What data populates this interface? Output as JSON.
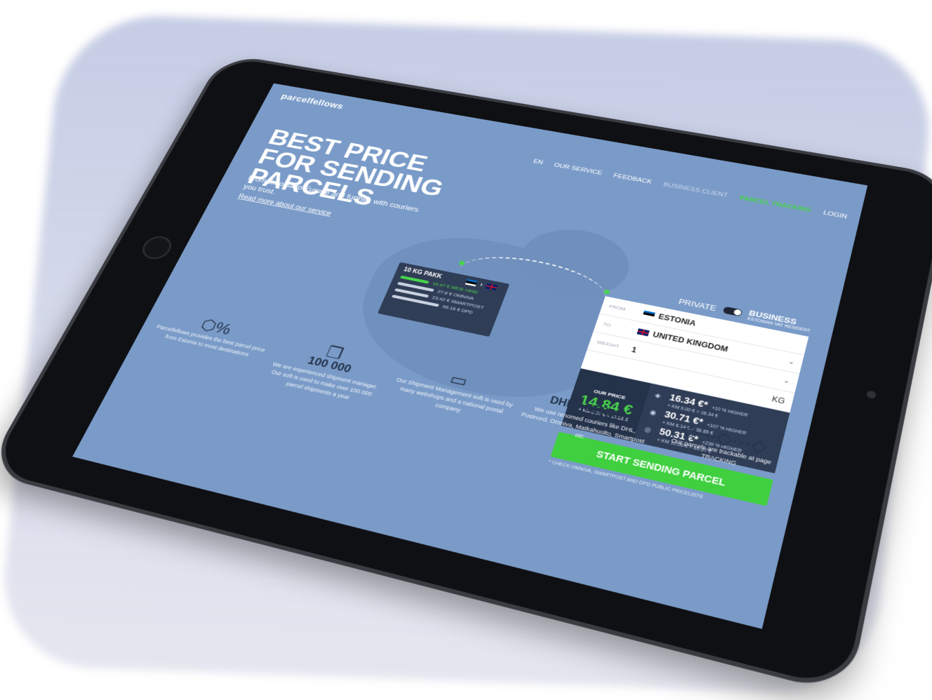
{
  "brand": "parcelfellows",
  "nav": {
    "items": [
      "EN",
      "OUR SERVICE",
      "FEEDBACK",
      "BUSINESS CLIENT",
      "PARCEL TRACKING",
      "LOGIN"
    ]
  },
  "hero": {
    "title": "BEST PRICE FOR SENDING PARCELS",
    "subtitle": "From Estonia to Europe and further, with couriers you trust.",
    "link": "Read more about our service"
  },
  "preview_card": {
    "title": "10 KG PAKK",
    "rows": [
      {
        "text": "16.47 € MEIE HIND",
        "highlight": true,
        "fill": 0.55
      },
      {
        "text": "27.6 € OMNIVA",
        "highlight": false,
        "fill": 0.7
      },
      {
        "text": "23.42 € SMARTPOST",
        "highlight": false,
        "fill": 0.65
      },
      {
        "text": "96.16 € DPD",
        "highlight": false,
        "fill": 0.9
      }
    ]
  },
  "form": {
    "private_label": "PRIVATE",
    "business_label": "BUSINESS",
    "business_sub": "ESTONIAN VAT RESIDENT",
    "from_label": "FROM",
    "from_value": "ESTONIA",
    "to_label": "TO",
    "to_value": "UNITED KINGDOM",
    "weight_label": "WEIGHT",
    "weight_value": "1",
    "weight_unit": "KG",
    "our_price_label": "OUR PRICE",
    "our_price": "14.84 €",
    "our_price_note": "+ KM 2.97 € = 17.81 €",
    "alternatives": [
      {
        "price": "16.34 €*",
        "note": "+10 % HIGHER",
        "km": "+ KM 0.00 € = 16.34 €"
      },
      {
        "price": "30.71 €*",
        "note": "+107 % HIGHER",
        "km": "+ KM 6.14 € = 36.85 €"
      },
      {
        "price": "50.31 €*",
        "note": "+239 % HIGHER",
        "km": "+ KM 10.06 € = 60.37 €"
      }
    ],
    "cta": "START SENDING PARCEL",
    "footnote": "* CHECK OMNIVA, SMARTPOST AND DPD PUBLIC PRICELISTS"
  },
  "features": [
    {
      "icon": "percent-badge-icon",
      "big": "",
      "text": "Parcelfellows provides the best parcel price from Estonia to most destinations"
    },
    {
      "icon": "boxes-icon",
      "big": "100 000",
      "text": "We are experienced shipment manager. Our soft is used to make over 100 000 parcel shipments a year"
    },
    {
      "icon": "certificate-icon",
      "big": "",
      "text": "Our Shipment Management soft is used by many webshops and a national postal company"
    },
    {
      "icon": "courier-logos-icon",
      "big": "DHL  ASENDIA",
      "text": "We use renomed couriers like DHL, Postnord, Omniva, Matkahuolto, Smartpost etc"
    },
    {
      "icon": "tracking-cubes-icon",
      "big": "",
      "text": "Our parcels are trackable at page TRACKING"
    }
  ]
}
